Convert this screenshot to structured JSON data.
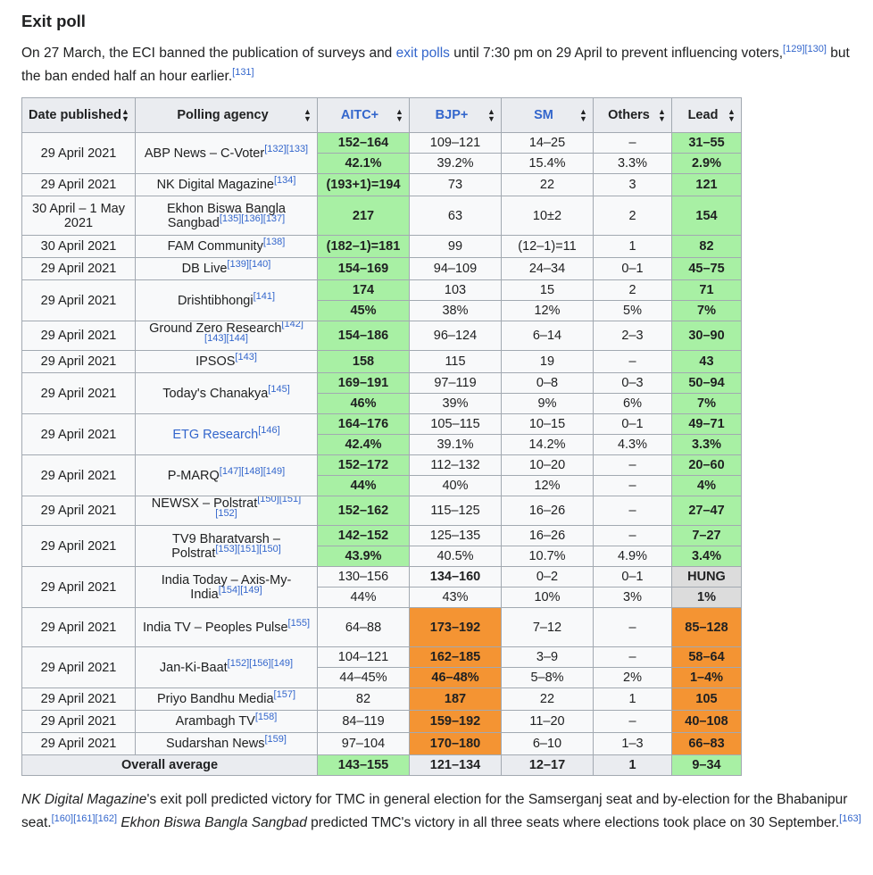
{
  "heading": "Exit poll",
  "intro": {
    "t1": "On 27 March, the ECI banned the publication of surveys and ",
    "link": "exit polls",
    "t2": " until 7:30 pm on 29 April to prevent influencing voters,",
    "refs1": "[129][130]",
    "t3": " but the ban ended half an hour earlier.",
    "refs2": "[131]"
  },
  "table": {
    "headers": {
      "date": "Date published",
      "agency": "Polling agency",
      "aitc": "AITC+",
      "bjp": "BJP+",
      "sm": "SM",
      "others": "Others",
      "lead": "Lead"
    },
    "colors": {
      "aitc": "#20c646",
      "bjp": "#ff9933",
      "sm": "#de0000",
      "others": "#a2a9b1"
    },
    "rows": [
      {
        "date": "29 April 2021",
        "agency": "ABP News – C-Voter",
        "refs": "[132][133]",
        "rowspan": 2,
        "r1": {
          "aitc": "152–164",
          "bjp": "109–121",
          "sm": "14–25",
          "others": "–",
          "lead": "31–55"
        },
        "r2": {
          "aitc": "42.1%",
          "bjp": "39.2%",
          "sm": "15.4%",
          "others": "3.3%",
          "lead": "2.9%"
        },
        "win": "aitc"
      },
      {
        "date": "29 April 2021",
        "agency": "NK Digital Magazine",
        "refs": "[134]",
        "rowspan": 1,
        "r1": {
          "aitc": "(193+1)=194",
          "bjp": "73",
          "sm": "22",
          "others": "3",
          "lead": "121"
        },
        "win": "aitc"
      },
      {
        "date": "30 April – 1 May 2021",
        "agency": "Ekhon Biswa Bangla Sangbad",
        "refs": "[135][136][137]",
        "rowspan": 1,
        "r1": {
          "aitc": "217",
          "bjp": "63",
          "sm": "10±2",
          "others": "2",
          "lead": "154"
        },
        "win": "aitc"
      },
      {
        "date": "30 April 2021",
        "agency": "FAM Community",
        "refs": "[138]",
        "rowspan": 1,
        "r1": {
          "aitc": "(182–1)=181",
          "bjp": "99",
          "sm": "(12–1)=11",
          "others": "1",
          "lead": "82"
        },
        "win": "aitc"
      },
      {
        "date": "29 April 2021",
        "agency": "DB Live",
        "refs": "[139][140]",
        "rowspan": 1,
        "r1": {
          "aitc": "154–169",
          "bjp": "94–109",
          "sm": "24–34",
          "others": "0–1",
          "lead": "45–75"
        },
        "win": "aitc"
      },
      {
        "date": "29 April 2021",
        "agency": "Drishtibhongi",
        "refs": "[141]",
        "rowspan": 2,
        "r1": {
          "aitc": "174",
          "bjp": "103",
          "sm": "15",
          "others": "2",
          "lead": "71"
        },
        "r2": {
          "aitc": "45%",
          "bjp": "38%",
          "sm": "12%",
          "others": "5%",
          "lead": "7%"
        },
        "win": "aitc"
      },
      {
        "date": "29 April 2021",
        "agency": "Ground Zero Research",
        "refs": "[142][143][144]",
        "rowspan": 1,
        "r1": {
          "aitc": "154–186",
          "bjp": "96–124",
          "sm": "6–14",
          "others": "2–3",
          "lead": "30–90"
        },
        "win": "aitc"
      },
      {
        "date": "29 April 2021",
        "agency": "IPSOS",
        "refs": "[143]",
        "rowspan": 1,
        "r1": {
          "aitc": "158",
          "bjp": "115",
          "sm": "19",
          "others": "–",
          "lead": "43"
        },
        "win": "aitc"
      },
      {
        "date": "29 April 2021",
        "agency": "Today's Chanakya",
        "refs": "[145]",
        "rowspan": 2,
        "r1": {
          "aitc": "169–191",
          "bjp": "97–119",
          "sm": "0–8",
          "others": "0–3",
          "lead": "50–94"
        },
        "r2": {
          "aitc": "46%",
          "bjp": "39%",
          "sm": "9%",
          "others": "6%",
          "lead": "7%"
        },
        "win": "aitc"
      },
      {
        "date": "29 April 2021",
        "agency": "ETG Research",
        "agencyLink": true,
        "refs": "[146]",
        "rowspan": 2,
        "r1": {
          "aitc": "164–176",
          "bjp": "105–115",
          "sm": "10–15",
          "others": "0–1",
          "lead": "49–71"
        },
        "r2": {
          "aitc": "42.4%",
          "bjp": "39.1%",
          "sm": "14.2%",
          "others": "4.3%",
          "lead": "3.3%"
        },
        "win": "aitc"
      },
      {
        "date": "29 April 2021",
        "agency": "P-MARQ",
        "refs": "[147][148][149]",
        "rowspan": 2,
        "r1": {
          "aitc": "152–172",
          "bjp": "112–132",
          "sm": "10–20",
          "others": "–",
          "lead": "20–60"
        },
        "r2": {
          "aitc": "44%",
          "bjp": "40%",
          "sm": "12%",
          "others": "–",
          "lead": "4%"
        },
        "win": "aitc"
      },
      {
        "date": "29 April 2021",
        "agency": "NEWSX – Polstrat",
        "refs": "[150][151][152]",
        "rowspan": 1,
        "r1": {
          "aitc": "152–162",
          "bjp": "115–125",
          "sm": "16–26",
          "others": "–",
          "lead": "27–47"
        },
        "win": "aitc"
      },
      {
        "date": "29 April 2021",
        "agency": "TV9 Bharatvarsh – Polstrat",
        "refs": "[153][151][150]",
        "rowspan": 2,
        "r1": {
          "aitc": "142–152",
          "bjp": "125–135",
          "sm": "16–26",
          "others": "–",
          "lead": "7–27"
        },
        "r2": {
          "aitc": "43.9%",
          "bjp": "40.5%",
          "sm": "10.7%",
          "others": "4.9%",
          "lead": "3.4%"
        },
        "win": "aitc"
      },
      {
        "date": "29 April 2021",
        "agency": "India Today – Axis-My-India",
        "refs": "[154][149]",
        "rowspan": 2,
        "r1": {
          "aitc": "130–156",
          "bjp": "134–160",
          "sm": "0–2",
          "others": "0–1",
          "lead": "HUNG"
        },
        "r2": {
          "aitc": "44%",
          "bjp": "43%",
          "sm": "10%",
          "others": "3%",
          "lead": "1%"
        },
        "win": "hung"
      },
      {
        "date": "29 April 2021",
        "agency": "India TV – Peoples Pulse",
        "refs": "[155]",
        "rowspan": 1,
        "r1": {
          "aitc": "64–88",
          "bjp": "173–192",
          "sm": "7–12",
          "others": "–",
          "lead": "85–128"
        },
        "win": "bjp"
      },
      {
        "date": "29 April 2021",
        "agency": "Jan-Ki-Baat",
        "refs": "[152][156][149]",
        "rowspan": 2,
        "r1": {
          "aitc": "104–121",
          "bjp": "162–185",
          "sm": "3–9",
          "others": "–",
          "lead": "58–64"
        },
        "r2": {
          "aitc": "44–45%",
          "bjp": "46–48%",
          "sm": "5–8%",
          "others": "2%",
          "lead": "1–4%"
        },
        "win": "bjp"
      },
      {
        "date": "29 April 2021",
        "agency": "Priyo Bandhu Media",
        "refs": "[157]",
        "rowspan": 1,
        "r1": {
          "aitc": "82",
          "bjp": "187",
          "sm": "22",
          "others": "1",
          "lead": "105"
        },
        "win": "bjp"
      },
      {
        "date": "29 April 2021",
        "agency": "Arambagh TV",
        "refs": "[158]",
        "rowspan": 1,
        "r1": {
          "aitc": "84–119",
          "bjp": "159–192",
          "sm": "11–20",
          "others": "–",
          "lead": "40–108"
        },
        "win": "bjp"
      },
      {
        "date": "29 April 2021",
        "agency": "Sudarshan News",
        "refs": "[159]",
        "rowspan": 1,
        "r1": {
          "aitc": "97–104",
          "bjp": "170–180",
          "sm": "6–10",
          "others": "1–3",
          "lead": "66–83"
        },
        "win": "bjp"
      }
    ],
    "average": {
      "label": "Overall average",
      "aitc": "143–155",
      "bjp": "121–134",
      "sm": "12–17",
      "others": "1",
      "lead": "9–34"
    }
  },
  "outro": {
    "em1": "NK Digital Magazine",
    "t1": "'s exit poll predicted victory for TMC in general election for the Samserganj seat and by-election for the Bhabanipur seat.",
    "refs1": "[160][161][162]",
    "em2": "Ekhon Biswa Bangla Sangbad",
    "t2": " predicted TMC's victory in all three seats where elections took place on 30 September.",
    "refs2": "[163]"
  }
}
